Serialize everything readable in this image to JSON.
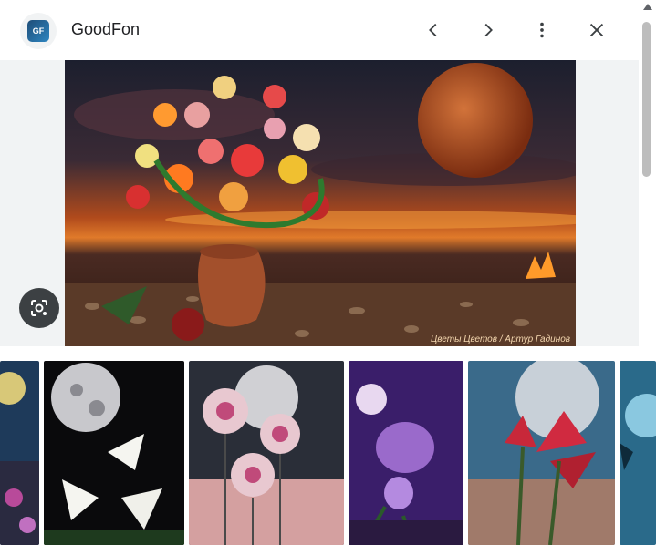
{
  "header": {
    "site_name": "GoodFon",
    "logo_text": "GF",
    "icons": [
      "chevron-left-icon",
      "chevron-right-icon",
      "more-vert-icon",
      "close-icon"
    ]
  },
  "main_image": {
    "watermark": "Цветы Цветов / Артур Гадинов"
  },
  "lens": {
    "icon": "lens-icon"
  },
  "colors": {
    "header_bg": "#ffffff",
    "panel_bg": "#f1f3f4",
    "lens_bg": "#3c4043",
    "text": "#202124"
  }
}
